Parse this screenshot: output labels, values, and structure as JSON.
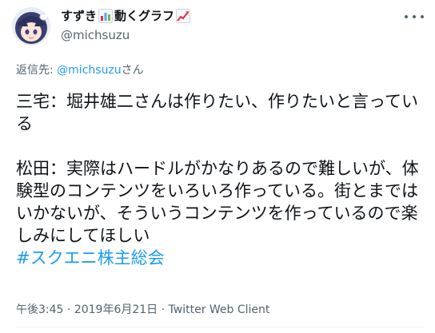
{
  "author": {
    "display_name_prefix": "すずき",
    "display_name_suffix": "動くグラフ",
    "handle": "@michsuzu",
    "bar_chart_icon": "bar-chart-emoji",
    "trend_icon": "chart-increasing-emoji"
  },
  "reply": {
    "label": "返信先: ",
    "mention": "@michsuzu",
    "suffix": "さん"
  },
  "tweet": {
    "text": "三宅：堀井雄二さんは作りたい、作りたいと言っている\n\n松田：実際はハードルがかなりあるので難しいが、体験型のコンテンツをいろいろ作っている。街とまではいかないが、そういうコンテンツを作っているので楽しみにしてほしい\n",
    "hashtag": "#スクエニ株主総会"
  },
  "meta": {
    "time": "午後3:45",
    "separator1": " · ",
    "date": "2019年6月21日",
    "separator2": " · ",
    "source": "Twitter Web Client"
  },
  "colors": {
    "link": "#1d9bf0",
    "muted": "#536471",
    "text": "#0f1419"
  },
  "icons": {
    "more": "more-options-icon",
    "avatar": "avatar"
  }
}
